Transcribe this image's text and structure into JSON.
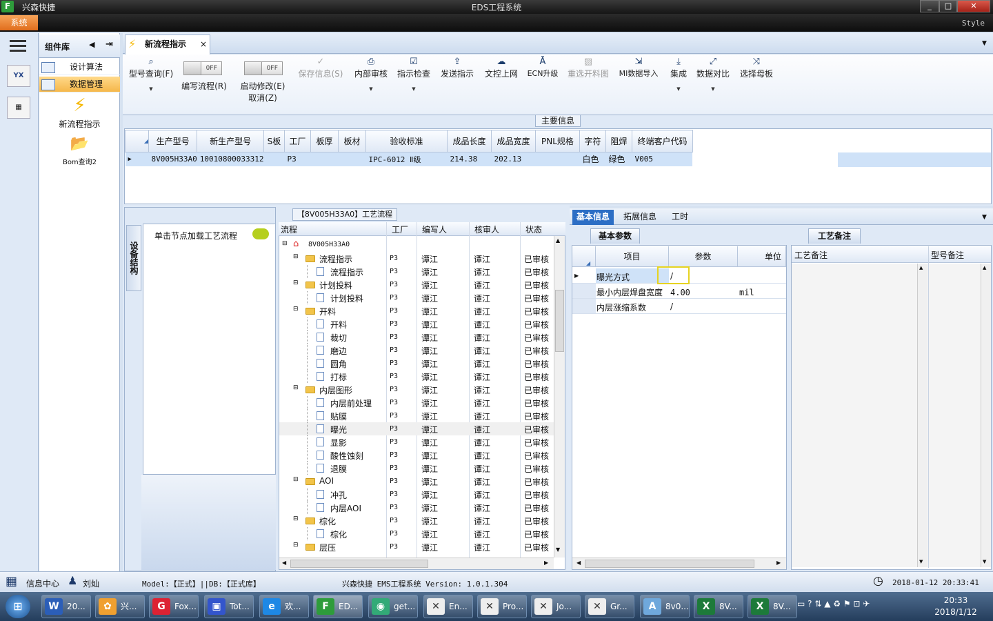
{
  "window": {
    "app_name": "兴森快捷",
    "title": "EDS工程系统",
    "minimize": "_",
    "maximize": "□",
    "close": "✕"
  },
  "menubar": {
    "system": "系统",
    "style": "Style"
  },
  "component_lib": {
    "title": "组件库",
    "items": [
      {
        "label": "设计算法"
      },
      {
        "label": "数据管理"
      }
    ],
    "big_items": [
      {
        "label": "新流程指示"
      },
      {
        "label": "Bom查询2"
      }
    ]
  },
  "doc_tab": {
    "label": "新流程指示",
    "close": "×"
  },
  "toolbar": {
    "buttons": [
      {
        "label": "型号查询(F)",
        "icon": "search-icon"
      },
      {
        "label": "编写流程(R)",
        "toggle": "OFF"
      },
      {
        "label": "启动修改(E)",
        "label2": "取消(Z)",
        "toggle": "OFF"
      },
      {
        "label": "保存信息(S)",
        "icon": "check-icon"
      },
      {
        "label": "内部审核",
        "icon": "print-icon"
      },
      {
        "label": "指示检查",
        "icon": "checkbox-icon"
      },
      {
        "label": "发送指示",
        "icon": "upload-icon"
      },
      {
        "label": "文控上网",
        "icon": "cloud-upload-icon"
      },
      {
        "label": "ECN升级",
        "icon": "ecn-icon"
      },
      {
        "label": "重选开料图",
        "icon": "image-icon"
      },
      {
        "label": "MI数据导入",
        "icon": "import-icon"
      },
      {
        "label": "集成",
        "icon": "download-icon"
      },
      {
        "label": "数据对比",
        "icon": "compare-icon"
      },
      {
        "label": "选择母板",
        "icon": "shuffle-icon"
      }
    ]
  },
  "main_info": {
    "title": "主要信息",
    "columns": [
      "生产型号",
      "新生产型号",
      "S板",
      "工厂",
      "板厚",
      "板材",
      "验收标准",
      "成品长度",
      "成品宽度",
      "PNL规格",
      "字符",
      "阻焊",
      "终端客户代码"
    ],
    "row": [
      "8V005H33A0",
      "10010800033312",
      "",
      "P3",
      "",
      "",
      "IPC-6012 Ⅱ级",
      "214.38",
      "202.13",
      "",
      "白色",
      "绿色",
      "V005"
    ]
  },
  "process": {
    "title": "【8V005H33A0】工艺流程",
    "side_tab": "设备结构",
    "hint": "单击节点加载工艺流程",
    "columns": [
      "流程",
      "工厂",
      "编写人",
      "核审人",
      "状态"
    ],
    "root": "8V005H33A0",
    "rows": [
      {
        "name": "流程指示",
        "level": 1,
        "type": "folder",
        "factory": "P3",
        "writer": "谭江",
        "reviewer": "谭江",
        "status": "已审核"
      },
      {
        "name": "流程指示",
        "level": 2,
        "type": "doc",
        "factory": "P3",
        "writer": "谭江",
        "reviewer": "谭江",
        "status": "已审核"
      },
      {
        "name": "计划投料",
        "level": 1,
        "type": "folder",
        "factory": "P3",
        "writer": "谭江",
        "reviewer": "谭江",
        "status": "已审核"
      },
      {
        "name": "计划投料",
        "level": 2,
        "type": "doc",
        "factory": "P3",
        "writer": "谭江",
        "reviewer": "谭江",
        "status": "已审核"
      },
      {
        "name": "开料",
        "level": 1,
        "type": "folder",
        "factory": "P3",
        "writer": "谭江",
        "reviewer": "谭江",
        "status": "已审核"
      },
      {
        "name": "开料",
        "level": 2,
        "type": "doc",
        "factory": "P3",
        "writer": "谭江",
        "reviewer": "谭江",
        "status": "已审核"
      },
      {
        "name": "裁切",
        "level": 2,
        "type": "doc",
        "factory": "P3",
        "writer": "谭江",
        "reviewer": "谭江",
        "status": "已审核"
      },
      {
        "name": "磨边",
        "level": 2,
        "type": "doc",
        "factory": "P3",
        "writer": "谭江",
        "reviewer": "谭江",
        "status": "已审核"
      },
      {
        "name": "圆角",
        "level": 2,
        "type": "doc",
        "factory": "P3",
        "writer": "谭江",
        "reviewer": "谭江",
        "status": "已审核"
      },
      {
        "name": "打标",
        "level": 2,
        "type": "doc",
        "factory": "P3",
        "writer": "谭江",
        "reviewer": "谭江",
        "status": "已审核"
      },
      {
        "name": "内层图形",
        "level": 1,
        "type": "folder",
        "factory": "P3",
        "writer": "谭江",
        "reviewer": "谭江",
        "status": "已审核"
      },
      {
        "name": "内层前处理",
        "level": 2,
        "type": "doc",
        "factory": "P3",
        "writer": "谭江",
        "reviewer": "谭江",
        "status": "已审核"
      },
      {
        "name": "贴膜",
        "level": 2,
        "type": "doc",
        "factory": "P3",
        "writer": "谭江",
        "reviewer": "谭江",
        "status": "已审核"
      },
      {
        "name": "曝光",
        "level": 2,
        "type": "doc",
        "factory": "P3",
        "writer": "谭江",
        "reviewer": "谭江",
        "status": "已审核",
        "selected": true
      },
      {
        "name": "显影",
        "level": 2,
        "type": "doc",
        "factory": "P3",
        "writer": "谭江",
        "reviewer": "谭江",
        "status": "已审核"
      },
      {
        "name": "酸性蚀刻",
        "level": 2,
        "type": "doc",
        "factory": "P3",
        "writer": "谭江",
        "reviewer": "谭江",
        "status": "已审核"
      },
      {
        "name": "退膜",
        "level": 2,
        "type": "doc",
        "factory": "P3",
        "writer": "谭江",
        "reviewer": "谭江",
        "status": "已审核"
      },
      {
        "name": "AOI",
        "level": 1,
        "type": "folder",
        "factory": "P3",
        "writer": "谭江",
        "reviewer": "谭江",
        "status": "已审核"
      },
      {
        "name": "冲孔",
        "level": 2,
        "type": "doc",
        "factory": "P3",
        "writer": "谭江",
        "reviewer": "谭江",
        "status": "已审核"
      },
      {
        "name": "内层AOI",
        "level": 2,
        "type": "doc",
        "factory": "P3",
        "writer": "谭江",
        "reviewer": "谭江",
        "status": "已审核"
      },
      {
        "name": "棕化",
        "level": 1,
        "type": "folder",
        "factory": "P3",
        "writer": "谭江",
        "reviewer": "谭江",
        "status": "已审核"
      },
      {
        "name": "棕化",
        "level": 2,
        "type": "doc",
        "factory": "P3",
        "writer": "谭江",
        "reviewer": "谭江",
        "status": "已审核"
      },
      {
        "name": "层压",
        "level": 1,
        "type": "folder",
        "factory": "P3",
        "writer": "谭江",
        "reviewer": "谭江",
        "status": "已审核"
      }
    ]
  },
  "right": {
    "tabs": [
      "基本信息",
      "拓展信息",
      "工时"
    ],
    "params_title": "基本参数",
    "params_columns": [
      "项目",
      "参数",
      "单位"
    ],
    "params": [
      {
        "item": "曝光方式",
        "value": "/",
        "unit": ""
      },
      {
        "item": "最小内层焊盘宽度",
        "value": "4.00",
        "unit": "mil"
      },
      {
        "item": "内层涨缩系数",
        "value": "/",
        "unit": ""
      }
    ],
    "memo_title": "工艺备注",
    "memo_columns": [
      "工艺备注",
      "型号备注"
    ]
  },
  "status": {
    "info_center": "信息中心",
    "user": "刘灿",
    "model": "Model:【正式】||DB:【正式库】",
    "version": "兴森快捷 EMS工程系统 Version: 1.0.1.304",
    "datetime": "2018-01-12 20:33:41"
  },
  "taskbar": {
    "items": [
      {
        "label": "20...",
        "color": "#2b5eb8",
        "glyph": "W"
      },
      {
        "label": "兴...",
        "color": "#f0a030",
        "glyph": "✿"
      },
      {
        "label": "Fox...",
        "color": "#d23",
        "glyph": "G"
      },
      {
        "label": "Tot...",
        "color": "#3355cc",
        "glyph": "▣"
      },
      {
        "label": "欢...",
        "color": "#1e88e5",
        "glyph": "e"
      },
      {
        "label": "ED...",
        "color": "#2e9c3b",
        "glyph": "F"
      },
      {
        "label": "get...",
        "color": "#3a7",
        "glyph": "◉"
      },
      {
        "label": "En...",
        "color": "#eee",
        "glyph": "✕"
      },
      {
        "label": "Pro...",
        "color": "#eee",
        "glyph": "✕"
      },
      {
        "label": "Jo...",
        "color": "#eee",
        "glyph": "✕"
      },
      {
        "label": "Gr...",
        "color": "#eee",
        "glyph": "✕"
      },
      {
        "label": "8v0...",
        "color": "#6fa8dc",
        "glyph": "A"
      },
      {
        "label": "8V...",
        "color": "#1d7a3a",
        "glyph": "X"
      },
      {
        "label": "8V...",
        "color": "#1d7a3a",
        "glyph": "X"
      }
    ],
    "time": "20:33",
    "date": "2018/1/12"
  }
}
